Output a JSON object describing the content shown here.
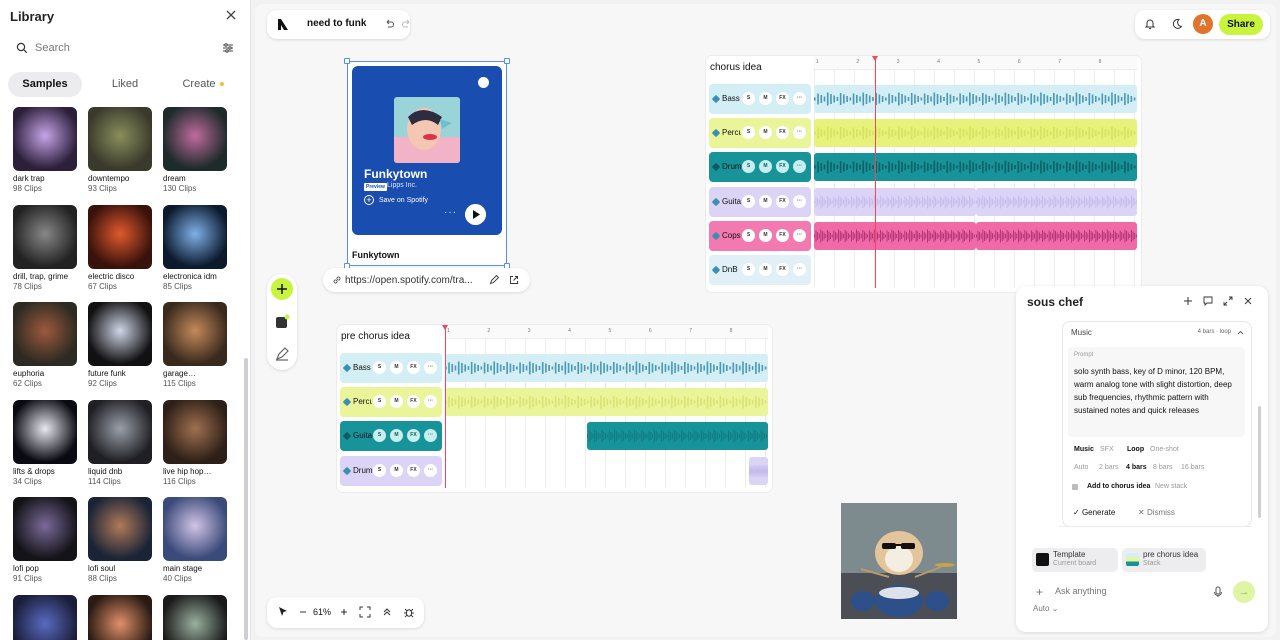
{
  "library": {
    "title": "Library",
    "search_placeholder": "Search",
    "tabs": [
      "Samples",
      "Liked",
      "Create"
    ],
    "items": [
      {
        "name": "dark trap",
        "count": "98 Clips"
      },
      {
        "name": "downtempo",
        "count": "93 Clips"
      },
      {
        "name": "dream",
        "count": "130 Clips"
      },
      {
        "name": "drill, trap, grime",
        "count": "78 Clips"
      },
      {
        "name": "electric disco",
        "count": "67 Clips"
      },
      {
        "name": "electronica idm",
        "count": "85 Clips"
      },
      {
        "name": "euphoria",
        "count": "62 Clips"
      },
      {
        "name": "future funk",
        "count": "92 Clips"
      },
      {
        "name": "garage…",
        "count": "115 Clips"
      },
      {
        "name": "lifts & drops",
        "count": "34 Clips"
      },
      {
        "name": "liquid dnb",
        "count": "114 Clips"
      },
      {
        "name": "live hip hop…",
        "count": "116 Clips"
      },
      {
        "name": "lofi pop",
        "count": "91 Clips"
      },
      {
        "name": "lofi soul",
        "count": "88 Clips"
      },
      {
        "name": "main stage",
        "count": "40 Clips"
      },
      {
        "name": "",
        "count": ""
      },
      {
        "name": "",
        "count": ""
      },
      {
        "name": "",
        "count": ""
      }
    ]
  },
  "project": {
    "title": "need to funk"
  },
  "header": {
    "avatar_letter": "A",
    "share_label": "Share"
  },
  "zoom": {
    "level": "61%"
  },
  "spotify_card": {
    "song": "Funkytown",
    "preview_badge": "Preview",
    "artist": "Lipps Inc.",
    "save_label": "Save on Spotify",
    "caption": "Funkytown",
    "url": "https://open.spotify.com/tra..."
  },
  "chorus_stack": {
    "title": "chorus idea",
    "ruler": [
      "1",
      "2",
      "3",
      "4",
      "5",
      "6",
      "7",
      "8"
    ],
    "tracks": [
      {
        "name": "Bass",
        "color": "#d4eef6",
        "region": "#d4eef6"
      },
      {
        "name": "Percussion",
        "color": "#eaf59a",
        "region": "#e6f27a"
      },
      {
        "name": "Drums",
        "color": "#17949a",
        "region": "#17949a"
      },
      {
        "name": "Guitar",
        "color": "#dcd4f6",
        "region": "#dcd4f6"
      },
      {
        "name": "Cops",
        "color": "#f27ab0",
        "region": "#f06aa8"
      },
      {
        "name": "DnB",
        "color": "#e0f0f6",
        "region": ""
      }
    ]
  },
  "prechorus_stack": {
    "title": "pre chorus idea",
    "ruler": [
      "1",
      "2",
      "3",
      "4",
      "5",
      "6",
      "7",
      "8"
    ],
    "tracks": [
      {
        "name": "Bass",
        "color": "#d4eef6"
      },
      {
        "name": "Percussion",
        "color": "#eaf59a"
      },
      {
        "name": "Guitar",
        "color": "#17949a"
      },
      {
        "name": "Drums",
        "color": "#dcd4f6"
      }
    ]
  },
  "track_buttons": [
    "S",
    "M",
    "FX",
    "···"
  ],
  "sous_chef": {
    "title": "sous chef",
    "music_label": "Music",
    "music_meta": "4 bars · loop",
    "prompt_label": "Prompt",
    "prompt": "solo synth bass, key of D minor, 120 BPM, warm analog tone with slight distortion, deep sub frequencies, rhythmic pattern with sustained notes and quick releases",
    "type_options": [
      "Music",
      "SFX",
      "Loop",
      "One-shot"
    ],
    "bar_options": [
      "Auto",
      "2 bars",
      "4 bars",
      "8 bars",
      "16 bars"
    ],
    "add_to": "Add to chorus idea",
    "new_stack": "New stack",
    "generate": "Generate",
    "dismiss": "Dismiss",
    "attachments": [
      {
        "title": "Template",
        "sub": "Current board"
      },
      {
        "title": "pre chorus idea",
        "sub": "Stack"
      }
    ],
    "ask_placeholder": "Ask anything",
    "mode": "Auto"
  }
}
